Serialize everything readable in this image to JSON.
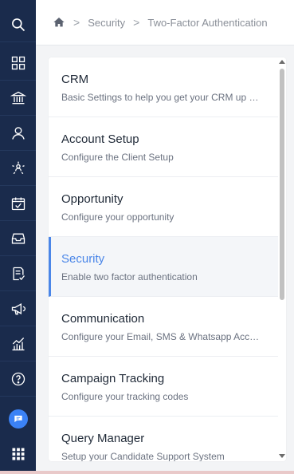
{
  "breadcrumb": {
    "home_icon": "home-icon",
    "separator": ">",
    "items": [
      "Security",
      "Two-Factor Authentication"
    ]
  },
  "sidebar": {
    "items": [
      {
        "icon": "search-icon"
      },
      {
        "icon": "dashboard-icon"
      },
      {
        "icon": "bank-icon"
      },
      {
        "icon": "user-icon"
      },
      {
        "icon": "network-user-icon"
      },
      {
        "icon": "calendar-check-icon"
      },
      {
        "icon": "inbox-icon"
      },
      {
        "icon": "task-list-icon"
      },
      {
        "icon": "megaphone-icon"
      },
      {
        "icon": "analytics-chart-icon"
      },
      {
        "icon": "help-icon"
      },
      {
        "icon": "chat-icon"
      },
      {
        "icon": "apps-grid-icon"
      }
    ]
  },
  "settings": {
    "items": [
      {
        "title": "CRM",
        "description": "Basic Settings to help you get your CRM up and running"
      },
      {
        "title": "Account Setup",
        "description": "Configure the Client Setup"
      },
      {
        "title": "Opportunity",
        "description": "Configure your opportunity"
      },
      {
        "title": "Security",
        "description": "Enable two factor authentication",
        "active": true
      },
      {
        "title": "Communication",
        "description": "Configure your Email, SMS & Whatsapp Accounts"
      },
      {
        "title": "Campaign Tracking",
        "description": "Configure your tracking codes"
      },
      {
        "title": "Query Manager",
        "description": "Setup your Candidate Support System"
      }
    ]
  },
  "colors": {
    "sidebar": "#1a2b4c",
    "accent": "#4a86e8",
    "chat_badge": "#3b82f6"
  }
}
